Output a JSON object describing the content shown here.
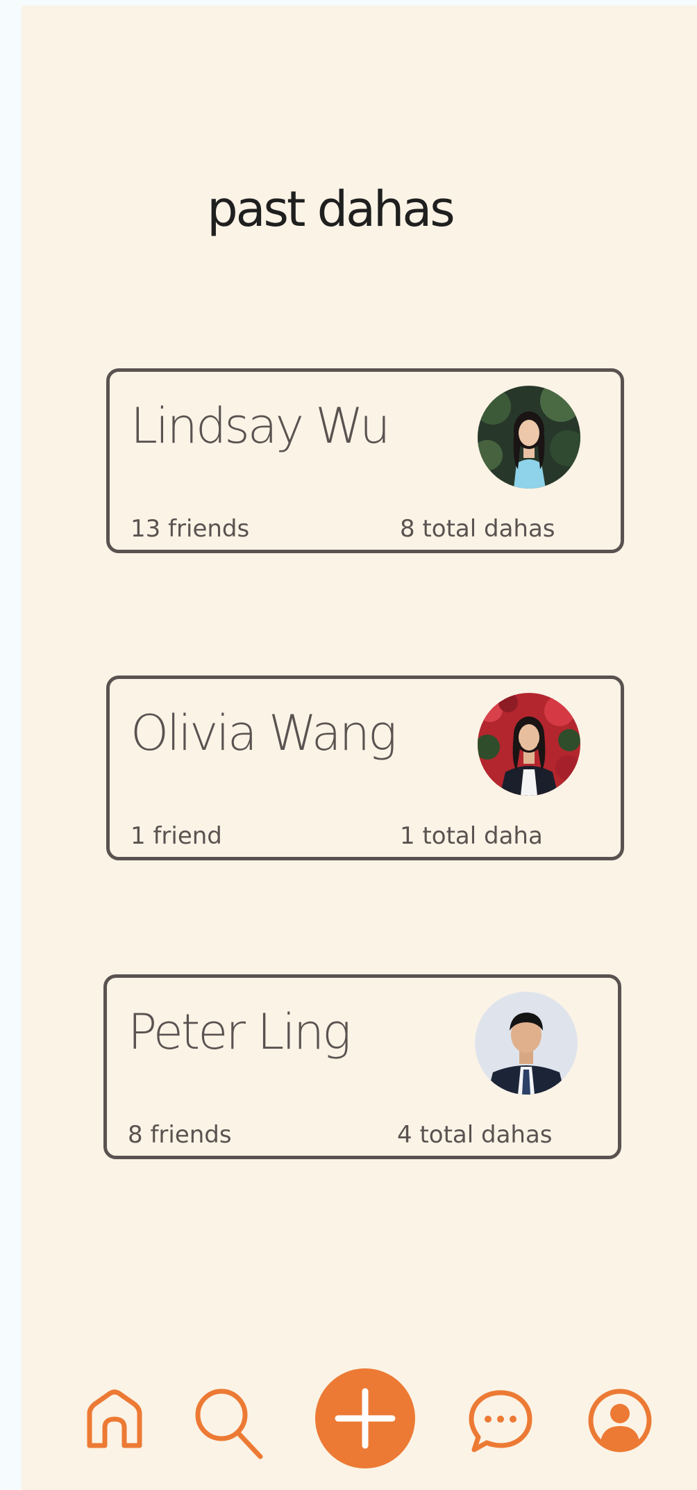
{
  "header": {
    "title": "past dahas"
  },
  "cards": [
    {
      "name": "Lindsay Wu",
      "friends": "13 friends",
      "dahas": "8 total dahas"
    },
    {
      "name": "Olivia Wang",
      "friends": "1 friend",
      "dahas": "1 total daha"
    },
    {
      "name": "Peter Ling",
      "friends": "8 friends",
      "dahas": "4 total dahas"
    }
  ],
  "nav": {
    "items": [
      {
        "icon": "home-icon"
      },
      {
        "icon": "search-icon"
      },
      {
        "icon": "add-icon"
      },
      {
        "icon": "chat-icon"
      },
      {
        "icon": "profile-icon"
      }
    ]
  },
  "colors": {
    "background": "#fbf3e6",
    "text": "#5a5250",
    "accent": "#ec7a34",
    "title": "#1f1f1f"
  }
}
